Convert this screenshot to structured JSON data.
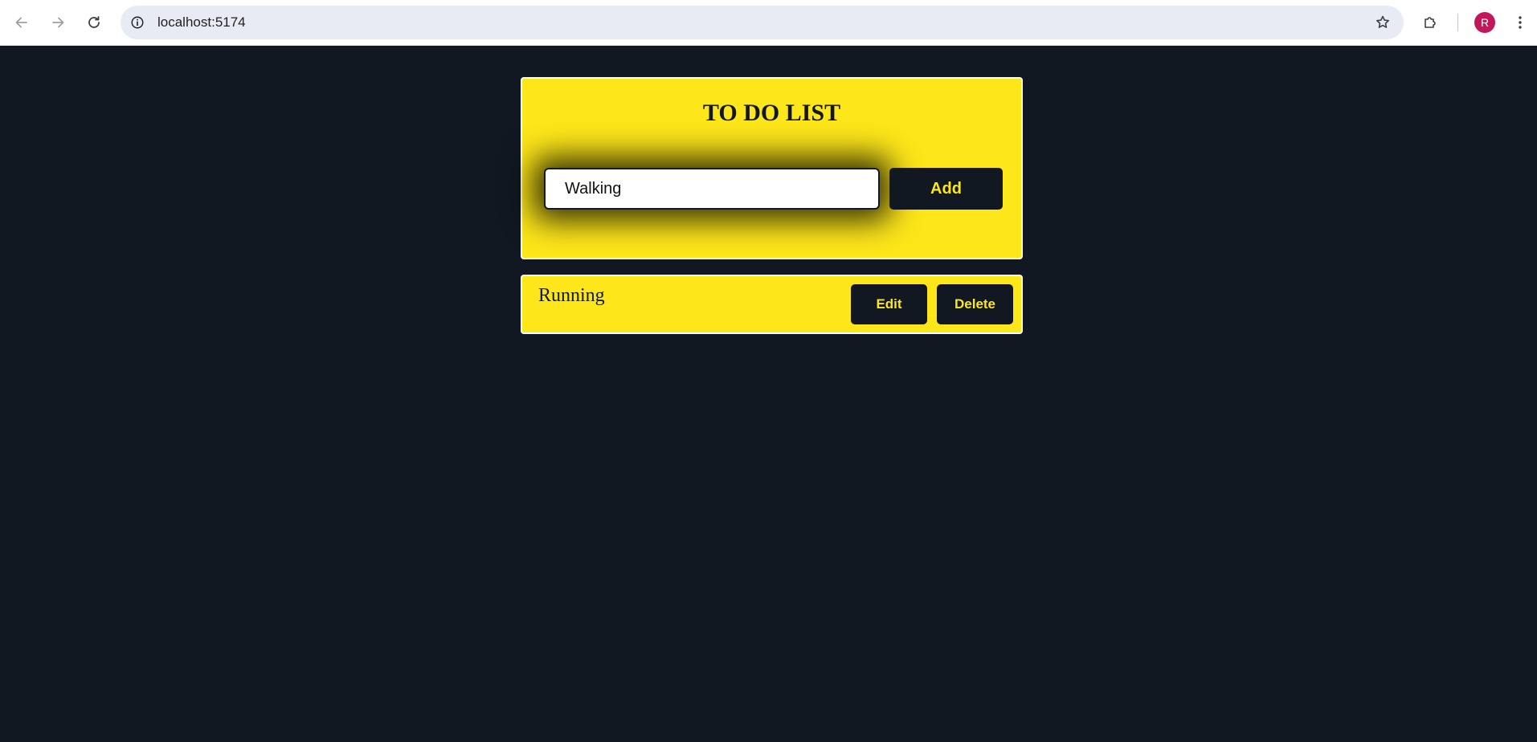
{
  "browser": {
    "url": "localhost:5174",
    "profile_initial": "R",
    "icons": {
      "back": "arrow-left-icon",
      "forward": "arrow-right-icon",
      "reload": "reload-icon",
      "site_info": "info-icon",
      "bookmark": "star-icon",
      "extensions": "puzzle-icon",
      "menu": "kebab-menu-icon"
    }
  },
  "app": {
    "title": "TO DO LIST",
    "input": {
      "value": "Walking"
    },
    "add_label": "Add",
    "items": [
      {
        "text": "Running",
        "edit_label": "Edit",
        "delete_label": "Delete"
      }
    ]
  },
  "colors": {
    "background": "#111821",
    "accent": "#fde619",
    "card_border": "#ffffff",
    "avatar": "#c2185b"
  }
}
